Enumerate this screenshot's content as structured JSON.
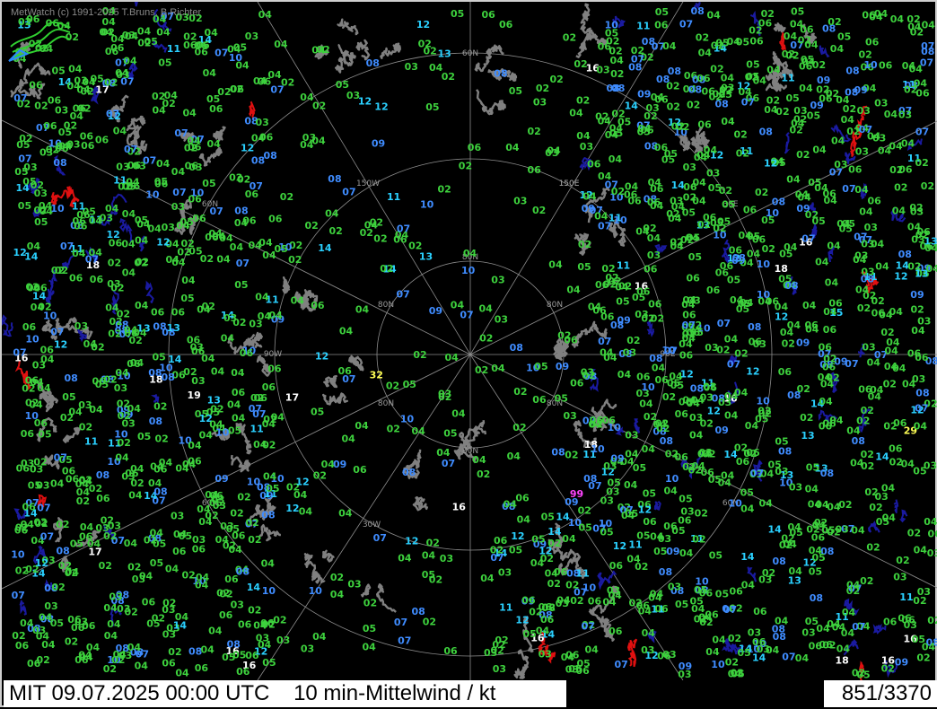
{
  "credit": "MetWatch  (c) 1991-2025 T.Bruns, B.Richter",
  "status": {
    "time_label": "MIT 09.07.2025 00:00 UTC",
    "product_label": "10 min-Mittelwind / kt",
    "count_label": "851/3370"
  },
  "grid_labels": [
    "60N",
    "80N",
    "80N",
    "80N",
    "80N",
    "80N",
    "80N",
    "60N",
    "60N",
    "60N",
    "150W",
    "150E",
    "150E",
    "90W",
    "90E",
    "30W",
    "30E"
  ],
  "colors": {
    "background": "#000000",
    "coastline": "#808080",
    "graticule": "#8c8c8c",
    "rivers": "#1a1aa0",
    "borders": "#e01010",
    "calm": "#3dd13d",
    "light": "#3f8cff",
    "moderate": "#2ad0ff",
    "fresh": "#ffffff",
    "strong": "#ffff55",
    "highlight": "#ff44ff"
  },
  "wind_values": [
    "16",
    "19",
    "18",
    "10",
    "06",
    "02",
    "06",
    "05",
    "04",
    "05",
    "08",
    "10",
    "14",
    "05",
    "04",
    "11",
    "14",
    "12",
    "10",
    "08",
    "10",
    "12",
    "14",
    "04",
    "05",
    "06",
    "09",
    "08",
    "10",
    "18",
    "14",
    "11",
    "07",
    "05",
    "04",
    "02",
    "12",
    "07",
    "10",
    "10",
    "17",
    "04",
    "02",
    "16",
    "08",
    "05",
    "03",
    "07",
    "07",
    "08",
    "04",
    "10",
    "29",
    "16",
    "04",
    "07",
    "08",
    "06",
    "06",
    "04",
    "02",
    "08",
    "09",
    "06",
    "32",
    "11",
    "13",
    "06",
    "10",
    "03",
    "06",
    "08",
    "05",
    "04",
    "02",
    "17",
    "11",
    "05",
    "13",
    "17",
    "14",
    "12",
    "10",
    "08",
    "08",
    "04",
    "06",
    "03",
    "07",
    "11",
    "02",
    "04",
    "13",
    "06",
    "05",
    "06",
    "07",
    "12",
    "06",
    "07",
    "14",
    "04",
    "03",
    "13",
    "02",
    "03",
    "11",
    "05",
    "06",
    "04",
    "09",
    "11",
    "10",
    "02",
    "04",
    "11",
    "06",
    "04",
    "16",
    "09",
    "07",
    "14",
    "13",
    "14",
    "10",
    "18",
    "12",
    "08",
    "99",
    "06",
    "08",
    "06",
    "04",
    "02",
    "04",
    "04",
    "08",
    "09",
    "06",
    "10",
    "02",
    "08",
    "02",
    "04",
    "02",
    "06",
    "02",
    "18",
    "10",
    "13",
    "15",
    "04",
    "07",
    "07",
    "07",
    "11",
    "03",
    "02",
    "08",
    "14",
    "10",
    "08",
    "02",
    "06",
    "04",
    "04",
    "06",
    "12",
    "10",
    "08",
    "04",
    "04",
    "05",
    "04",
    "16",
    "05",
    "02",
    "04",
    "10",
    "09",
    "04",
    "06",
    "03",
    "03",
    "10",
    "11",
    "18",
    "06",
    "10",
    "14",
    "09",
    "12",
    "08",
    "10",
    "05",
    "04",
    "04",
    "04",
    "09",
    "12",
    "04",
    "09",
    "14",
    "14",
    "05",
    "05",
    "06",
    "08",
    "09",
    "12",
    "06",
    "03",
    "03",
    "03",
    "04",
    "09",
    "08",
    "05",
    "14",
    "06",
    "02",
    "06",
    "08",
    "04",
    "02",
    "03",
    "11",
    "12",
    "08",
    "06",
    "12",
    "12",
    "08",
    "12",
    "05",
    "04",
    "02",
    "04",
    "05",
    "11",
    "06",
    "11",
    "12",
    "09",
    "02",
    "08",
    "04",
    "10",
    "14",
    "06",
    "08",
    "16",
    "07",
    "05",
    "11",
    "11",
    "06",
    "08",
    "07",
    "02",
    "06",
    "03",
    "02",
    "02",
    "04",
    "04",
    "02",
    "10",
    "05",
    "10",
    "02",
    "05",
    "03",
    "02",
    "05",
    "07",
    "08",
    "11",
    "07",
    "07",
    "11",
    "10",
    "04",
    "04",
    "05",
    "06",
    "08",
    "14",
    "04",
    "06",
    "07",
    "08",
    "03",
    "05",
    "02",
    "03",
    "12",
    "07",
    "06",
    "09",
    "03",
    "14",
    "14",
    "06",
    "04",
    "05",
    "02",
    "04",
    "10",
    "06",
    "04",
    "04",
    "06",
    "08",
    "06",
    "04",
    "04",
    "05",
    "14",
    "09",
    "05",
    "06",
    "12",
    "06",
    "04",
    "03",
    "04",
    "16",
    "04",
    "02",
    "06",
    "04",
    "04",
    "03",
    "04",
    "11",
    "04",
    "04",
    "03",
    "10",
    "05",
    "03",
    "14",
    "12",
    "10",
    "02",
    "08",
    "14",
    "04",
    "09",
    "05",
    "02",
    "04",
    "02",
    "03",
    "05",
    "06",
    "04",
    "04",
    "02",
    "02",
    "04",
    "07",
    "06",
    "09",
    "06",
    "05",
    "05",
    "03",
    "04",
    "06",
    "02",
    "06",
    "05",
    "02",
    "08",
    "10",
    "02",
    "04",
    "04",
    "06",
    "06",
    "05",
    "03",
    "16",
    "05",
    "02",
    "06",
    "05",
    "13",
    "09",
    "02",
    "08",
    "10",
    "04",
    "05",
    "06",
    "06",
    "07",
    "03",
    "08",
    "02",
    "04",
    "03",
    "02",
    "08",
    "04",
    "03",
    "06",
    "07",
    "04",
    "06",
    "06",
    "04",
    "06",
    "04",
    "03",
    "02",
    "08",
    "02",
    "04",
    "02",
    "06",
    "04",
    "02",
    "02",
    "08",
    "07",
    "06",
    "04",
    "06",
    "04",
    "06",
    "11",
    "02",
    "05",
    "06",
    "06",
    "07",
    "05",
    "11",
    "03",
    "04",
    "03",
    "04",
    "04",
    "02",
    "02",
    "04",
    "02",
    "08",
    "09",
    "03",
    "04",
    "07",
    "16",
    "03",
    "02",
    "05",
    "08",
    "13",
    "07",
    "05",
    "10",
    "06",
    "06",
    "03",
    "02",
    "08",
    "02",
    "07",
    "05",
    "04",
    "03",
    "06",
    "10",
    "02",
    "12",
    "07",
    "14",
    "02",
    "02",
    "03",
    "10",
    "06",
    "02",
    "04",
    "04",
    "04",
    "11",
    "14",
    "02",
    "08",
    "04",
    "08",
    "06",
    "02",
    "14",
    "10",
    "10",
    "06",
    "12",
    "08",
    "02",
    "03",
    "04",
    "12",
    "09",
    "06",
    "07",
    "16",
    "08",
    "10",
    "04",
    "02",
    "04",
    "05",
    "02",
    "06",
    "08",
    "04",
    "03",
    "06",
    "12",
    "03",
    "03",
    "10",
    "08",
    "03",
    "06",
    "02",
    "05",
    "14",
    "02",
    "08",
    "04",
    "02",
    "04",
    "02",
    "05",
    "03",
    "04",
    "06",
    "13",
    "06",
    "02",
    "10",
    "07",
    "04",
    "04",
    "04",
    "10",
    "05",
    "08",
    "02",
    "06",
    "03",
    "08",
    "02",
    "02",
    "06",
    "07",
    "10",
    "08",
    "06",
    "03",
    "06",
    "07",
    "04",
    "05",
    "06",
    "07",
    "04",
    "04",
    "14",
    "04",
    "06",
    "02",
    "06",
    "03",
    "08",
    "03",
    "04",
    "14",
    "05",
    "04",
    "08",
    "06",
    "03",
    "06",
    "12",
    "10",
    "04",
    "04",
    "04",
    "12",
    "06",
    "02",
    "04",
    "08",
    "03",
    "04",
    "02",
    "14",
    "05",
    "11",
    "10",
    "04",
    "04",
    "02",
    "04",
    "02",
    "03",
    "05",
    "08",
    "02",
    "04",
    "06",
    "03",
    "12",
    "02",
    "10",
    "12",
    "04",
    "02",
    "06",
    "04",
    "11",
    "04",
    "06",
    "08",
    "03",
    "04",
    "03",
    "16",
    "10",
    "04",
    "02",
    "05",
    "02",
    "02",
    "03",
    "08",
    "05",
    "08",
    "06",
    "06",
    "04",
    "04",
    "04",
    "04",
    "11",
    "04",
    "02",
    "04",
    "08",
    "06",
    "04",
    "04",
    "06",
    "10",
    "08",
    "07",
    "05",
    "03",
    "04",
    "03",
    "02",
    "03",
    "04",
    "02",
    "02",
    "06",
    "07",
    "06",
    "03",
    "12",
    "04",
    "12",
    "08",
    "10",
    "07",
    "02",
    "08",
    "02",
    "02",
    "03",
    "13",
    "03",
    "04",
    "10",
    "13",
    "07",
    "02",
    "03",
    "05",
    "03",
    "04",
    "03",
    "02",
    "04",
    "03",
    "04",
    "06",
    "06",
    "04",
    "02",
    "12",
    "07",
    "02",
    "11",
    "03",
    "04",
    "05",
    "04",
    "07",
    "04",
    "11",
    "04",
    "04",
    "04",
    "04",
    "08",
    "06",
    "08",
    "07",
    "03",
    "06",
    "07",
    "08",
    "02",
    "04",
    "04",
    "04",
    "03",
    "14",
    "08",
    "08",
    "02",
    "02",
    "12",
    "04",
    "11",
    "13",
    "03",
    "06",
    "02",
    "10",
    "07",
    "03",
    "02",
    "09",
    "04",
    "06",
    "07",
    "02",
    "04",
    "02",
    "05",
    "05",
    "12",
    "02",
    "06",
    "02",
    "05",
    "08",
    "07",
    "03",
    "09",
    "02",
    "04",
    "06",
    "05",
    "13",
    "07",
    "04",
    "05",
    "02",
    "05",
    "07",
    "06",
    "06",
    "02",
    "02",
    "07",
    "05",
    "04",
    "04",
    "06",
    "03",
    "04",
    "06",
    "02",
    "05",
    "04",
    "04",
    "04",
    "04",
    "03",
    "07",
    "08",
    "04",
    "06",
    "05",
    "02",
    "06",
    "04",
    "06",
    "06",
    "04",
    "04",
    "06",
    "06",
    "04",
    "04",
    "04",
    "04",
    "02",
    "04",
    "02",
    "04",
    "08",
    "06",
    "07",
    "08",
    "04",
    "14",
    "05",
    "04",
    "07",
    "04",
    "02",
    "05",
    "04",
    "02",
    "03",
    "04",
    "04",
    "02",
    "04",
    "04",
    "04",
    "02",
    "08",
    "04",
    "03",
    "06",
    "03",
    "04",
    "08",
    "10",
    "06",
    "06",
    "04",
    "06",
    "03",
    "07",
    "06",
    "02",
    "02",
    "07",
    "06",
    "06",
    "04",
    "05",
    "04",
    "04",
    "04",
    "02",
    "06",
    "03",
    "02",
    "04",
    "04",
    "05",
    "05",
    "02",
    "04",
    "04",
    "02",
    "02",
    "06",
    "08",
    "04",
    "02",
    "06",
    "04",
    "04",
    "08",
    "11",
    "02",
    "02",
    "04",
    "05",
    "03",
    "06",
    "06",
    "04",
    "05",
    "08",
    "02",
    "04",
    "02",
    "10",
    "04",
    "07",
    "07",
    "06",
    "03",
    "05",
    "08",
    "08",
    "02",
    "06",
    "06",
    "03",
    "04",
    "02",
    "12",
    "07",
    "04",
    "05",
    "07",
    "02",
    "07",
    "07",
    "04",
    "04",
    "06",
    "02",
    "04",
    "02",
    "02",
    "04",
    "06",
    "04",
    "03",
    "02",
    "08",
    "02",
    "03",
    "02",
    "04",
    "05",
    "02",
    "06",
    "02",
    "03",
    "02",
    "04",
    "07",
    "07",
    "05",
    "04",
    "09",
    "06",
    "05",
    "12",
    "03",
    "06",
    "07",
    "10",
    "02",
    "04",
    "02",
    "02",
    "06",
    "08",
    "02",
    "02",
    "04",
    "08",
    "09",
    "12",
    "03",
    "02",
    "04",
    "07",
    "03",
    "02",
    "03",
    "10",
    "02",
    "03",
    "03",
    "04",
    "03",
    "05",
    "02",
    "06",
    "04",
    "02",
    "06",
    "04",
    "05",
    "02",
    "05",
    "02",
    "07",
    "04",
    "03",
    "04",
    "06",
    "08",
    "04",
    "04",
    "02",
    "02",
    "02",
    "05",
    "05",
    "04",
    "06",
    "04",
    "02",
    "06",
    "04",
    "04",
    "09",
    "04",
    "02",
    "02",
    "06",
    "06",
    "08",
    "03",
    "02",
    "04",
    "04",
    "09",
    "05",
    "02",
    "02",
    "08",
    "04",
    "04",
    "04",
    "05",
    "04",
    "04",
    "08",
    "06",
    "06",
    "06",
    "09",
    "02",
    "07",
    "09",
    "12",
    "02",
    "12",
    "07",
    "04",
    "09",
    "05",
    "06",
    "02",
    "06",
    "04",
    "02",
    "08",
    "07",
    "04",
    "03",
    "08",
    "04",
    "04",
    "03",
    "02",
    "07",
    "04",
    "08",
    "08",
    "04",
    "05",
    "08",
    "04",
    "07",
    "06",
    "05",
    "02",
    "07",
    "05",
    "02",
    "06",
    "02",
    "03",
    "03",
    "03",
    "06",
    "04",
    "02",
    "02",
    "04",
    "02",
    "02",
    "02",
    "04",
    "02",
    "07",
    "06",
    "07",
    "04",
    "04",
    "06",
    "03",
    "02",
    "06",
    "06",
    "05",
    "08",
    "06",
    "04",
    "06",
    "03",
    "03",
    "07",
    "02",
    "05",
    "02",
    "04",
    "02",
    "02",
    "04",
    "06",
    "02",
    "04",
    "10",
    "07",
    "03",
    "06",
    "07",
    "04",
    "06",
    "05",
    "04",
    "04",
    "06",
    "07",
    "04",
    "02",
    "02",
    "06",
    "06",
    "04",
    "04",
    "09",
    "02",
    "04",
    "06",
    "04",
    "04",
    "05",
    "04",
    "06",
    "06",
    "06",
    "05",
    "06",
    "05",
    "02",
    "04",
    "07",
    "05",
    "04",
    "03",
    "04",
    "06",
    "06",
    "08",
    "04",
    "02",
    "02",
    "04",
    "04",
    "03",
    "03",
    "06",
    "04",
    "04",
    "07",
    "04",
    "02",
    "04",
    "06",
    "04",
    "06",
    "04",
    "03",
    "03",
    "05",
    "07",
    "05",
    "02",
    "02",
    "06",
    "02",
    "04",
    "05",
    "04",
    "04",
    "04",
    "06",
    "08",
    "02",
    "02",
    "02",
    "03",
    "06",
    "06",
    "07",
    "02",
    "03",
    "03",
    "02",
    "04",
    "03",
    "07",
    "06",
    "04",
    "06",
    "04",
    "04",
    "06",
    "02",
    "05",
    "03",
    "04",
    "04",
    "03",
    "02",
    "06",
    "02",
    "06",
    "04",
    "06",
    "02",
    "04",
    "06",
    "06",
    "04",
    "04",
    "04",
    "04",
    "02",
    "04",
    "04",
    "03",
    "04",
    "03",
    "05",
    "02",
    "02",
    "05",
    "07",
    "04",
    "04",
    "07",
    "07",
    "02",
    "04",
    "02",
    "05",
    "02",
    "05",
    "02",
    "04",
    "04",
    "02",
    "02",
    "02",
    "06",
    "02",
    "02",
    "04",
    "04",
    "04",
    "04",
    "06",
    "03",
    "02",
    "02",
    "04",
    "04",
    "05",
    "05",
    "03",
    "06",
    "04",
    "03",
    "06",
    "05",
    "05",
    "04",
    "06",
    "05",
    "06",
    "04",
    "02",
    "04",
    "02",
    "04",
    "02",
    "02",
    "03",
    "04",
    "05",
    "04",
    "04",
    "03",
    "04",
    "05",
    "02",
    "04",
    "05",
    "02",
    "06",
    "04",
    "04",
    "06",
    "05",
    "04",
    "07",
    "02",
    "06",
    "04",
    "02",
    "03",
    "02",
    "03",
    "06",
    "02",
    "02",
    "04",
    "02",
    "02",
    "03",
    "02",
    "06",
    "02",
    "03",
    "02",
    "02",
    "04",
    "02",
    "04",
    "05",
    "02",
    "05",
    "06",
    "02",
    "04",
    "04",
    "04",
    "04",
    "03",
    "04",
    "06",
    "03",
    "04",
    "02",
    "04",
    "03",
    "03",
    "02",
    "05",
    "02",
    "04",
    "04",
    "06",
    "02",
    "02",
    "06",
    "03",
    "02",
    "02",
    "06",
    "04",
    "02",
    "02",
    "05",
    "04",
    "04",
    "05",
    "06",
    "04",
    "02",
    "05",
    "02",
    "02",
    "04",
    "04",
    "03",
    "02",
    "05",
    "04",
    "06",
    "06",
    "05",
    "02",
    "04",
    "06",
    "02",
    "04",
    "06",
    "03",
    "05",
    "03",
    "02",
    "02",
    "02",
    "02",
    "04",
    "05",
    "04",
    "02",
    "02",
    "04",
    "04",
    "04",
    "02",
    "04",
    "02",
    "04",
    "02",
    "04",
    "06",
    "04",
    "02",
    "03",
    "02",
    "02",
    "02",
    "02",
    "04",
    "02",
    "04",
    "06",
    "02",
    "04",
    "02",
    "04",
    "05",
    "03",
    "03",
    "02",
    "02",
    "06",
    "04",
    "05",
    "02",
    "02",
    "04",
    "04",
    "06",
    "04",
    "02",
    "04",
    "02",
    "05",
    "04",
    "02",
    "06",
    "04",
    "02",
    "05",
    "04",
    "02",
    "04",
    "02",
    "04",
    "02",
    "03",
    "02",
    "02",
    "04",
    "02",
    "05",
    "04",
    "02",
    "02",
    "04",
    "04",
    "04",
    "05",
    "04",
    "02",
    "04",
    "04",
    "02",
    "04",
    "04",
    "04",
    "05",
    "04",
    "04",
    "02",
    "02",
    "04",
    "04",
    "04",
    "04",
    "03",
    "04",
    "02",
    "04",
    "05",
    "02",
    "04",
    "04",
    "04",
    "04",
    "02",
    "05",
    "02",
    "04",
    "04",
    "04",
    "04",
    "04",
    "02",
    "04",
    "05",
    "04",
    "05",
    "04",
    "02",
    "04",
    "05",
    "04",
    "04",
    "04",
    "02",
    "04",
    "04",
    "02",
    "04",
    "04",
    "02",
    "04",
    "05",
    "04",
    "04",
    "02"
  ]
}
